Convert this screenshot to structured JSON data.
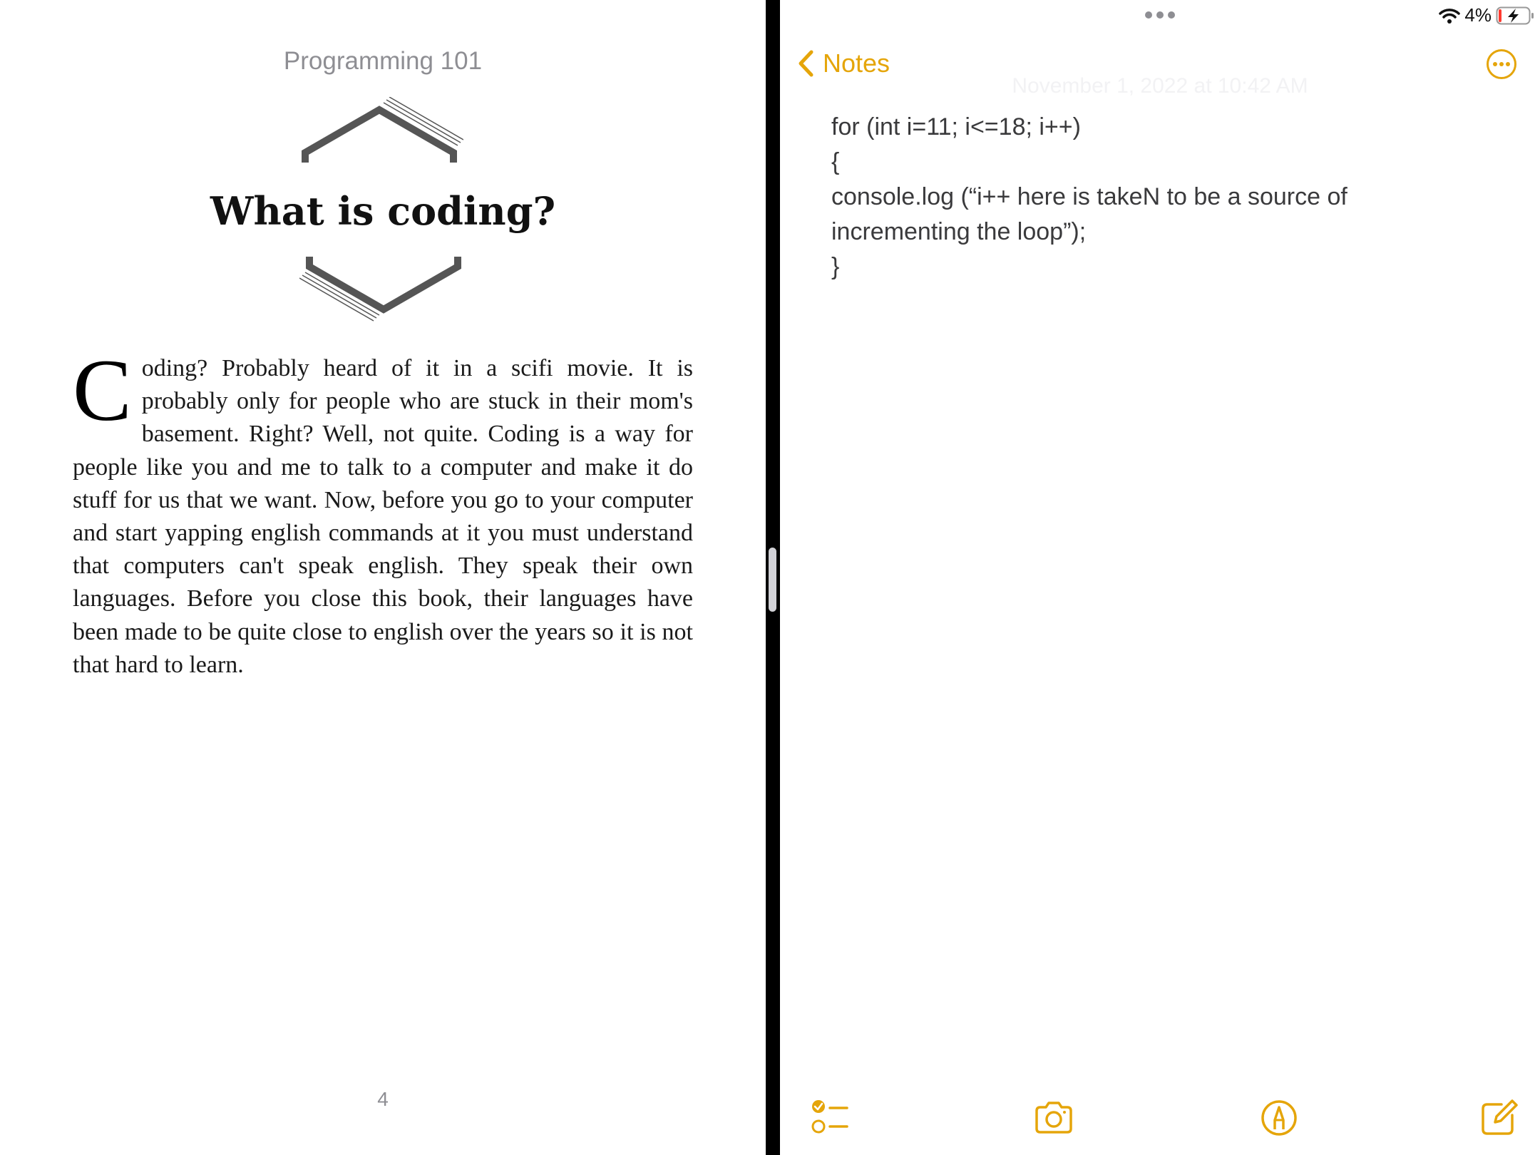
{
  "book": {
    "header": "Programming 101",
    "chapter_title": "What is coding?",
    "drop_cap": "C",
    "body": "oding? Probably heard of it in a scifi movie. It is probably only for people who are stuck in their mom's basement. Right? Well, not quite. Coding is a way for people like you and me to talk to a computer and make it do stuff for us that we want. Now, before you go to your computer and start yapping english commands at it you must understand that computers can't speak english. They speak their own languages. Before you close this book, their languages have been made to be quite close to english over the years so it is not that hard to learn.",
    "page_number": "4"
  },
  "status_bar": {
    "battery": "4%",
    "icons": [
      "wifi-icon",
      "battery-charging-icon"
    ]
  },
  "notes": {
    "back_label": "Notes",
    "date": "November 1, 2022 at 10:42 AM",
    "lines": [
      "for (int i=11; i<=18; i++)",
      "{",
      "console.log (“i++ here is takeN to be a source of",
      "incrementing the loop”);",
      "}"
    ],
    "toolbar": [
      "checklist-icon",
      "camera-icon",
      "markup-icon",
      "compose-icon"
    ]
  },
  "colors": {
    "accent": "#e5a50a",
    "divider": "#000000",
    "secondary_text": "#8e8e93"
  }
}
